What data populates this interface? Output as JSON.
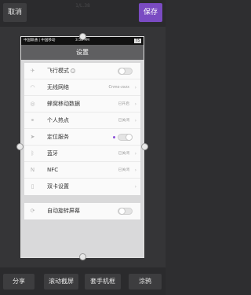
{
  "toolbar": {
    "cancel_label": "取消",
    "save_label": "保存",
    "faint_title": "1/L.38"
  },
  "phone": {
    "status_bar": {
      "carriers": "中国联通 | 中国移动",
      "time": "3:51 PM",
      "battery": "75"
    },
    "title": "设置",
    "group1": [
      {
        "icon": "airplane-icon",
        "label": "飞行模式",
        "toggle": "off",
        "info": true
      },
      {
        "icon": "wifi-icon",
        "label": "无线网络",
        "value": "Cnmo-zxzx"
      },
      {
        "icon": "mobile-data-icon",
        "label": "蜂窝移动数据",
        "value": "已开启"
      },
      {
        "icon": "hotspot-icon",
        "label": "个人热点",
        "value": "已关闭"
      },
      {
        "icon": "location-icon",
        "label": "定位服务",
        "toggle": "on"
      },
      {
        "icon": "bluetooth-icon",
        "label": "蓝牙",
        "value": "已关闭"
      },
      {
        "icon": "nfc-icon",
        "label": "NFC",
        "value": "已关闭"
      },
      {
        "icon": "sim-icon",
        "label": "双卡设置"
      }
    ],
    "group2": [
      {
        "icon": "rotate-lock-icon",
        "label": "自动旋转屏幕",
        "toggle": "off"
      }
    ]
  },
  "bottom_bar": {
    "share_label": "分享",
    "scroll_screenshot_label": "滚动截屏",
    "phone_frame_label": "套手机框",
    "doodle_label": "涂鸦"
  },
  "colors": {
    "accent": "#7a4bc2",
    "background": "#2e2e30"
  }
}
